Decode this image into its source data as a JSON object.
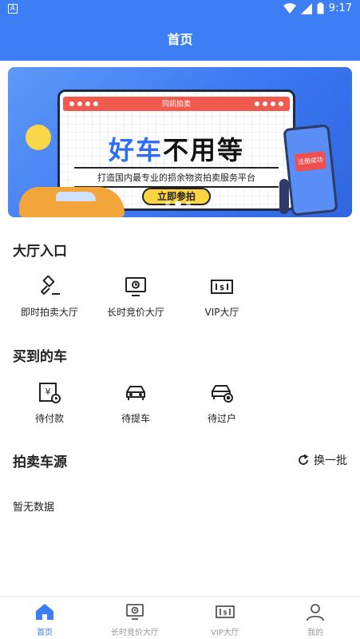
{
  "status_bar": {
    "time": "9:17",
    "left_icon_text": "A"
  },
  "header": {
    "title": "首页"
  },
  "banner": {
    "tag": "同凯拍卖",
    "headline_blue": "好车",
    "headline_dark": "不用等",
    "subtitle": "打造国内最专业的损余物资拍卖服务平台",
    "cta": "立即参拍",
    "phone_badge": "注册成功",
    "pages": 3,
    "active_page": 1
  },
  "hall": {
    "title": "大厅入口",
    "items": [
      {
        "label": "即时拍卖大厅",
        "icon": "auction-hammer-icon"
      },
      {
        "label": "长时竞价大厅",
        "icon": "monitor-clock-icon"
      },
      {
        "label": "VIP大厅",
        "icon": "vip-ticket-icon"
      }
    ]
  },
  "bought": {
    "title": "买到的车",
    "items": [
      {
        "label": "待付款",
        "icon": "payment-pending-icon"
      },
      {
        "label": "待提车",
        "icon": "car-pickup-icon"
      },
      {
        "label": "待过户",
        "icon": "car-transfer-icon"
      }
    ]
  },
  "auction_source": {
    "title": "拍卖车源",
    "refresh_label": "换一批",
    "empty_text": "暂无数据"
  },
  "tabbar": {
    "items": [
      {
        "label": "首页",
        "icon": "home-icon",
        "active": true
      },
      {
        "label": "长时竞价大厅",
        "icon": "monitor-clock-icon",
        "active": false
      },
      {
        "label": "VIP大厅",
        "icon": "vip-ticket-icon",
        "active": false
      },
      {
        "label": "我的",
        "icon": "user-icon",
        "active": false
      }
    ]
  },
  "colors": {
    "primary": "#3d7ef5",
    "inactive": "#9a9a9a"
  }
}
